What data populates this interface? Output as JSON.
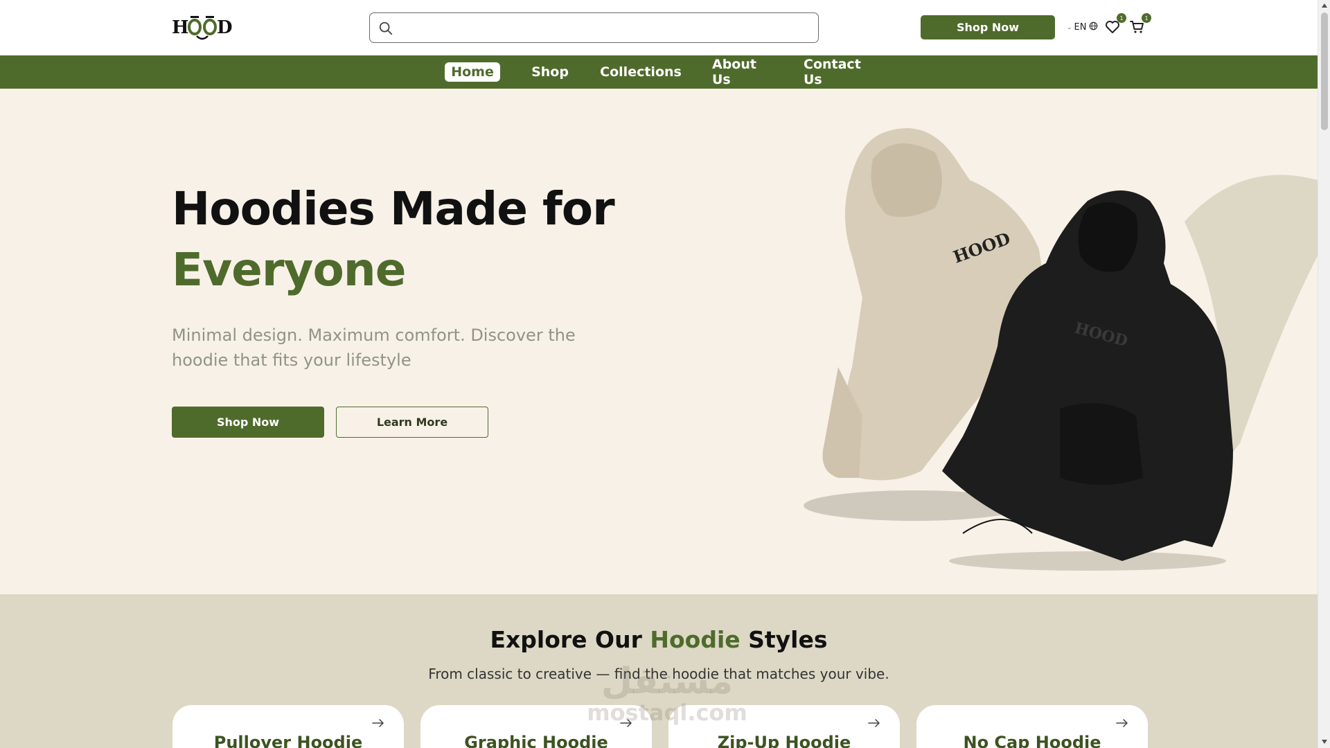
{
  "header": {
    "logo_text": "HOOD",
    "search": {
      "value": "",
      "placeholder": ""
    },
    "shop_now_label": "Shop Now",
    "language": "EN",
    "wishlist_count": "1",
    "cart_count": "1"
  },
  "nav": {
    "items": [
      {
        "label": "Home",
        "active": true
      },
      {
        "label": "Shop",
        "active": false
      },
      {
        "label": "Collections",
        "active": false
      },
      {
        "label": "About Us",
        "active": false
      },
      {
        "label": "Contact Us",
        "active": false
      }
    ]
  },
  "hero": {
    "title_line1": "Hoodies Made for",
    "title_line2": "Everyone",
    "subtitle": "Minimal design. Maximum comfort. Discover the hoodie that fits your lifestyle",
    "primary_button": "Shop Now",
    "secondary_button": "Learn More",
    "image_logo_text": "HOOD"
  },
  "explore": {
    "title_before": "Explore Our ",
    "title_accent": "Hoodie",
    "title_after": " Styles",
    "subtitle": "From classic to creative — find the hoodie that matches your vibe.",
    "cards": [
      {
        "name": "Pullover Hoodie"
      },
      {
        "name": "Graphic Hoodie"
      },
      {
        "name": "Zip-Up Hoodie"
      },
      {
        "name": "No Cap Hoodie"
      }
    ]
  },
  "watermark": {
    "line1": "مستقل",
    "line2": "mostaql.com"
  },
  "colors": {
    "brand_green": "#4f6b2c",
    "page_background": "#f8f1e8",
    "explore_background": "#ddd8c5",
    "subtitle_gray": "#8f9485"
  },
  "icons": [
    "search-icon",
    "chevron-down-icon",
    "globe-icon",
    "heart-icon",
    "cart-icon",
    "arrow-right-icon"
  ]
}
